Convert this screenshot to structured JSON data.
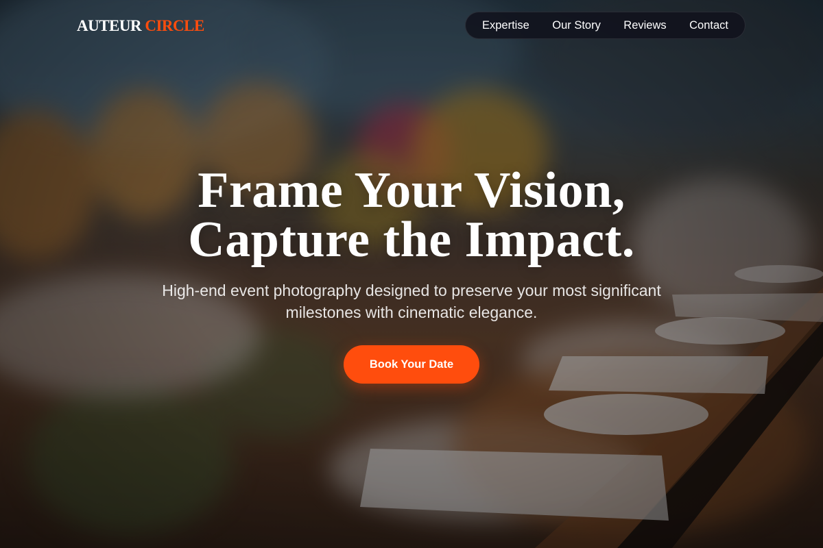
{
  "brand": {
    "logo_word_1": "AUTEUR",
    "logo_word_2": "CIRCLE"
  },
  "nav": {
    "items": [
      {
        "label": "Expertise"
      },
      {
        "label": "Our Story"
      },
      {
        "label": "Reviews"
      },
      {
        "label": "Contact"
      }
    ]
  },
  "hero": {
    "title_line_1": "Frame Your Vision,",
    "title_line_2": "Capture the Impact.",
    "subtitle_line_1": "High-end event photography designed to preserve your most significant",
    "subtitle_line_2": "milestones with cinematic elegance.",
    "cta_label": "Book Your Date"
  },
  "colors": {
    "accent": "#ff4d0d",
    "nav_background": "#10121c",
    "text": "#ffffff"
  }
}
